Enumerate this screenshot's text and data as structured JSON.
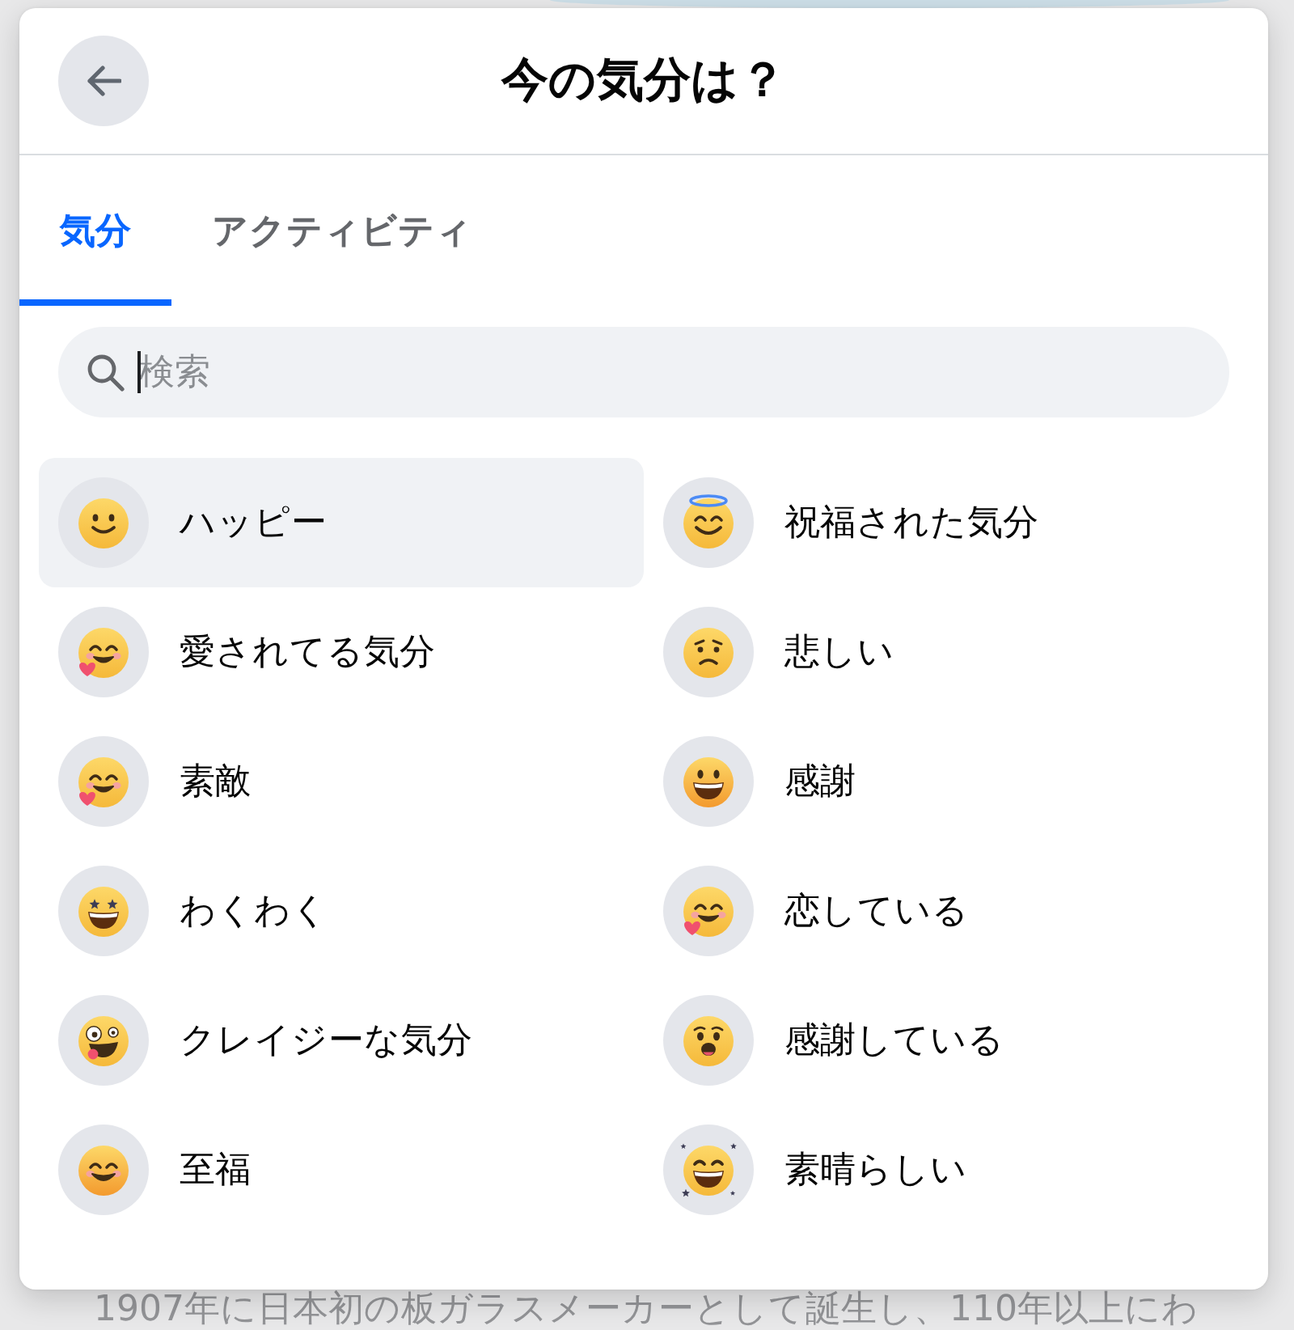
{
  "dialog": {
    "title": "今の気分は？"
  },
  "tabs": [
    {
      "label": "気分",
      "selected": true
    },
    {
      "label": "アクティビティ",
      "selected": false
    }
  ],
  "search": {
    "placeholder": "検索",
    "focused": true
  },
  "moods": [
    {
      "label": "ハッピー",
      "kind": "smile",
      "selected": true
    },
    {
      "label": "祝福された気分",
      "kind": "halo",
      "selected": false
    },
    {
      "label": "愛されてる気分",
      "kind": "hug",
      "selected": false
    },
    {
      "label": "悲しい",
      "kind": "worried",
      "selected": false
    },
    {
      "label": "素敵",
      "kind": "hug",
      "selected": false
    },
    {
      "label": "感謝",
      "kind": "grin",
      "selected": false
    },
    {
      "label": "わくわく",
      "kind": "starstruck",
      "selected": false
    },
    {
      "label": "恋している",
      "kind": "hug",
      "selected": false
    },
    {
      "label": "クレイジーな気分",
      "kind": "zany",
      "selected": false
    },
    {
      "label": "感謝している",
      "kind": "pleading",
      "selected": false
    },
    {
      "label": "至福",
      "kind": "blush",
      "selected": false
    },
    {
      "label": "素晴らしい",
      "kind": "sparkle",
      "selected": false
    }
  ],
  "background": {
    "text": "1907年に日本初の板ガラスメーカーとして誕生し、110年以上にわ"
  }
}
